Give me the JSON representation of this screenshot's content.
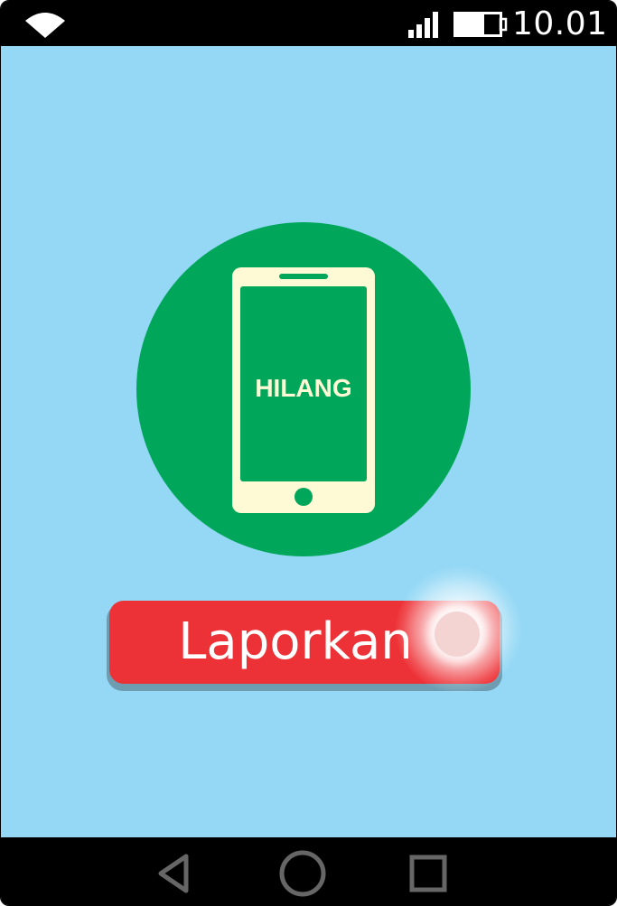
{
  "status_bar": {
    "time": "10.01",
    "icons": [
      "wifi-icon",
      "signal-icon",
      "battery-icon"
    ]
  },
  "hero": {
    "phone_screen_text": "HILANG",
    "icon": "smartphone-icon"
  },
  "report_button": {
    "label": "Laporkan"
  },
  "nav_bar": {
    "icons": [
      "back-icon",
      "home-icon",
      "recent-apps-icon"
    ]
  },
  "colors": {
    "background": "#94d8f5",
    "circle": "#00a75a",
    "phone": "#fffad6",
    "button": "#ed3237",
    "bars": "#000000"
  }
}
